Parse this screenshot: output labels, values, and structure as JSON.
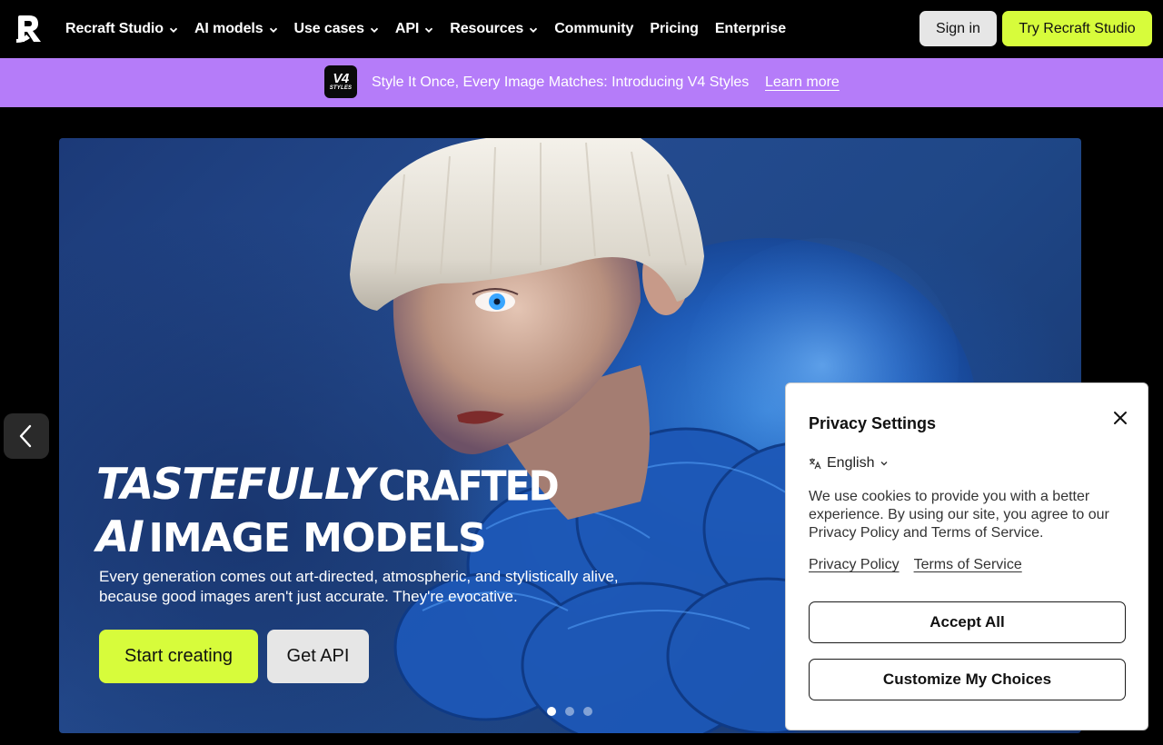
{
  "nav": {
    "logo": "recraft-logo",
    "items": [
      {
        "label": "Recraft Studio",
        "dropdown": true
      },
      {
        "label": "AI models",
        "dropdown": true
      },
      {
        "label": "Use cases",
        "dropdown": true
      },
      {
        "label": "API",
        "dropdown": true
      },
      {
        "label": "Resources",
        "dropdown": true
      },
      {
        "label": "Community",
        "dropdown": false
      },
      {
        "label": "Pricing",
        "dropdown": false
      },
      {
        "label": "Enterprise",
        "dropdown": false
      }
    ],
    "signin_label": "Sign in",
    "try_label": "Try Recraft Studio"
  },
  "banner": {
    "badge_main": "V4",
    "badge_sub": "STYLES",
    "text": "Style It Once, Every Image Matches: Introducing V4 Styles",
    "link": "Learn more"
  },
  "hero": {
    "headline_1a": "TASTEFULLY",
    "headline_1b": "CRAFTED",
    "headline_2a": "AI",
    "headline_2b": "IMAGE MODELS",
    "subtitle": "Every generation comes out art-directed, atmospheric, and stylistically alive, because good images aren't just accurate. They're evocative.",
    "start_label": "Start creating",
    "api_label": "Get API",
    "slides": 3,
    "active_slide": 1
  },
  "privacy": {
    "title": "Privacy Settings",
    "language": "English",
    "text": "We use cookies to provide you with a better experience. By using our site, you agree to our Privacy Policy and Terms of Service.",
    "policy_link": "Privacy Policy",
    "terms_link": "Terms of Service",
    "accept_label": "Accept All",
    "customize_label": "Customize My Choices"
  },
  "colors": {
    "accent_lime": "#d7fc3b",
    "banner_purple": "#b57cf9",
    "hero_blue": "#1f4787"
  }
}
